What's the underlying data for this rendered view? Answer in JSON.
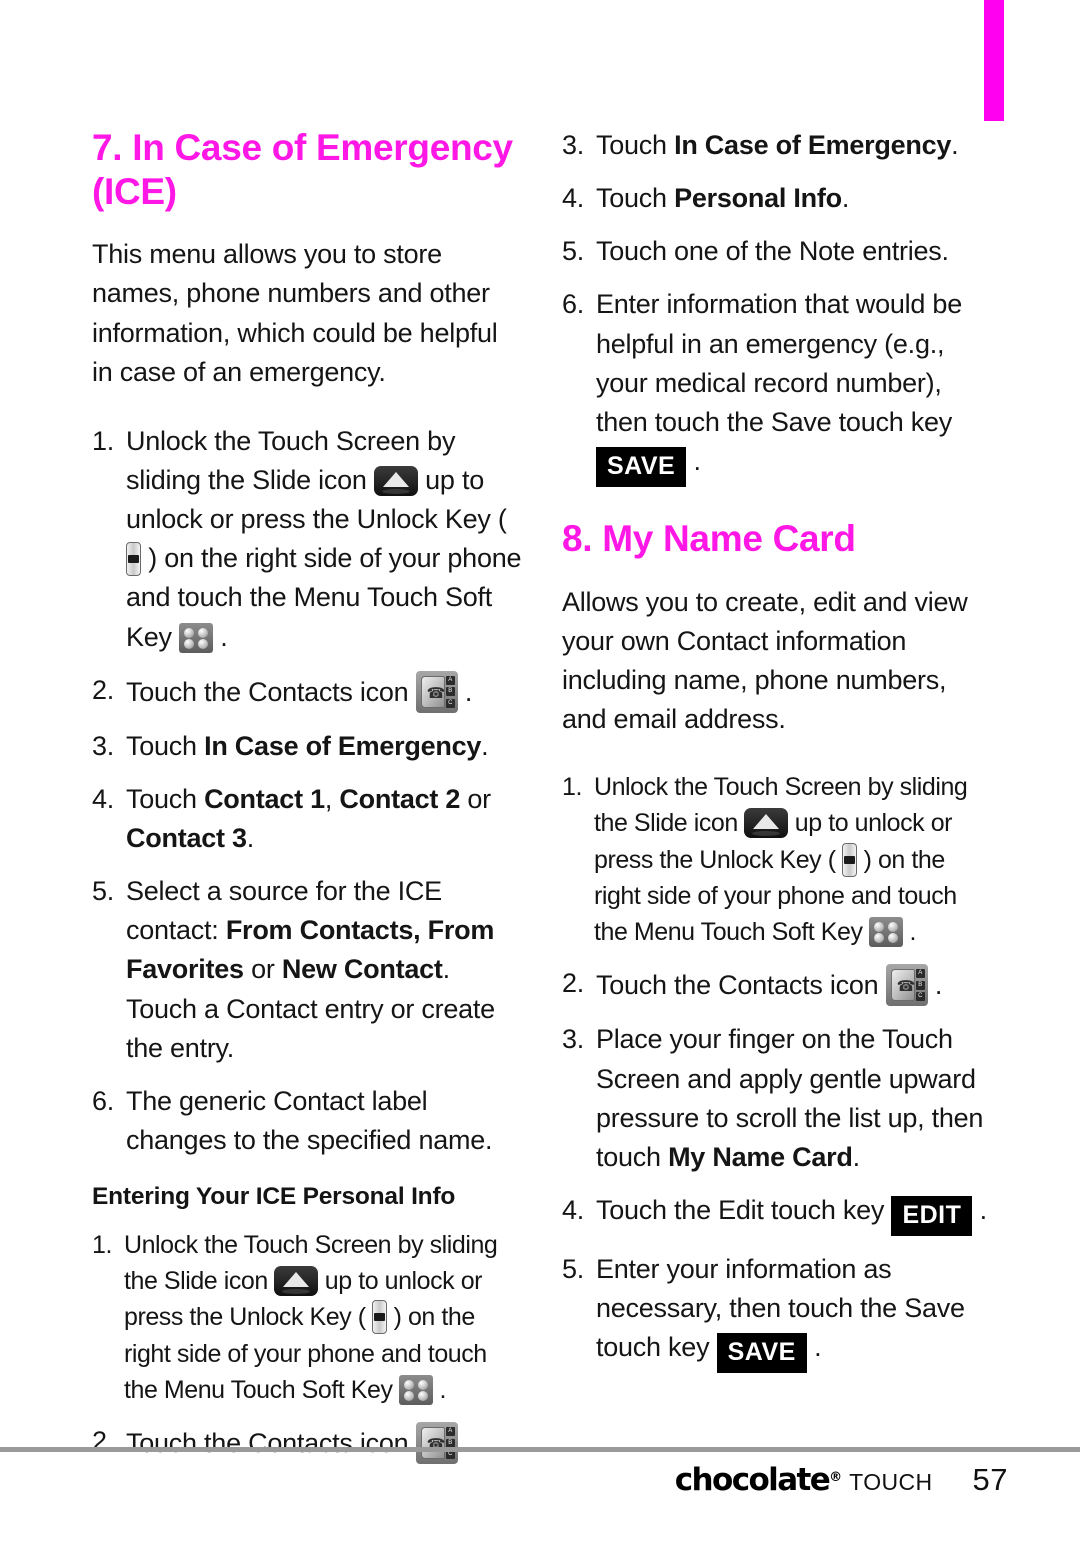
{
  "colors": {
    "heading_pink": "#ff17e6",
    "edge_tab": "#ff00f0",
    "body_text": "#151515",
    "key_badge_bg": "#000000",
    "footer_rule": "#9a9a9a"
  },
  "left_column": {
    "chapter_heading_line1": "7. In Case of Emergency",
    "chapter_heading_line2": "(ICE)",
    "intro": "This menu allows you to store names, phone numbers and other information, which could be helpful in case of an emergency.",
    "steps": [
      {
        "num": "1.",
        "parts": [
          {
            "t": "text",
            "v": "Unlock the Touch Screen by sliding the Slide icon "
          },
          {
            "t": "icon",
            "v": "slide-icon"
          },
          {
            "t": "text",
            "v": " up to unlock or press the Unlock Key ( "
          },
          {
            "t": "icon",
            "v": "unlock-key-icon"
          },
          {
            "t": "text",
            "v": " ) on the right side of your phone and touch the Menu Touch Soft Key "
          },
          {
            "t": "icon",
            "v": "menu-soft-key-icon"
          },
          {
            "t": "text",
            "v": " ."
          }
        ]
      },
      {
        "num": "2.",
        "parts": [
          {
            "t": "text",
            "v": "Touch the Contacts icon "
          },
          {
            "t": "icon",
            "v": "contacts-icon"
          },
          {
            "t": "text",
            "v": " ."
          }
        ]
      },
      {
        "num": "3.",
        "parts": [
          {
            "t": "text",
            "v": "Touch "
          },
          {
            "t": "bold",
            "v": "In Case of Emergency"
          },
          {
            "t": "text",
            "v": "."
          }
        ]
      },
      {
        "num": "4.",
        "parts": [
          {
            "t": "text",
            "v": "Touch "
          },
          {
            "t": "bold",
            "v": "Contact 1"
          },
          {
            "t": "text",
            "v": ", "
          },
          {
            "t": "bold",
            "v": "Contact 2"
          },
          {
            "t": "text",
            "v": " or "
          },
          {
            "t": "bold",
            "v": "Contact 3"
          },
          {
            "t": "text",
            "v": "."
          }
        ]
      },
      {
        "num": "5.",
        "parts": [
          {
            "t": "text",
            "v": "Select a source for the ICE contact: "
          },
          {
            "t": "bold",
            "v": "From Contacts, From Favorites"
          },
          {
            "t": "text",
            "v": " or "
          },
          {
            "t": "bold",
            "v": "New Contact"
          },
          {
            "t": "text",
            "v": ". Touch a Contact entry or create the entry."
          }
        ]
      },
      {
        "num": "6.",
        "parts": [
          {
            "t": "text",
            "v": "The generic Contact label changes to the specified name."
          }
        ]
      }
    ],
    "subheading": "Entering Your ICE Personal Info",
    "sub_steps": [
      {
        "num": "1.",
        "parts": [
          {
            "t": "text",
            "v": "Unlock the Touch Screen by sliding the Slide icon "
          },
          {
            "t": "icon",
            "v": "slide-icon"
          },
          {
            "t": "text",
            "v": " up to unlock or press the Unlock Key ( "
          },
          {
            "t": "icon",
            "v": "unlock-key-icon"
          },
          {
            "t": "text",
            "v": " ) on the right side of your phone and touch the Menu Touch Soft Key "
          },
          {
            "t": "icon",
            "v": "menu-soft-key-icon"
          },
          {
            "t": "text",
            "v": " ."
          }
        ]
      },
      {
        "num": "2.",
        "parts": [
          {
            "t": "text",
            "v": "Touch the Contacts icon "
          },
          {
            "t": "icon",
            "v": "contacts-icon"
          },
          {
            "t": "text",
            "v": " ."
          }
        ]
      }
    ]
  },
  "right_column": {
    "cont_steps": [
      {
        "num": "3.",
        "parts": [
          {
            "t": "text",
            "v": "Touch "
          },
          {
            "t": "bold",
            "v": "In Case of Emergency"
          },
          {
            "t": "text",
            "v": "."
          }
        ]
      },
      {
        "num": "4.",
        "parts": [
          {
            "t": "text",
            "v": "Touch "
          },
          {
            "t": "bold",
            "v": "Personal Info"
          },
          {
            "t": "text",
            "v": "."
          }
        ]
      },
      {
        "num": "5.",
        "parts": [
          {
            "t": "text",
            "v": "Touch one of the Note entries."
          }
        ]
      },
      {
        "num": "6.",
        "parts": [
          {
            "t": "text",
            "v": "Enter information that would be helpful in an emergency (e.g., your medical record number), then touch the Save touch key "
          },
          {
            "t": "badge",
            "v": "SAVE"
          },
          {
            "t": "text",
            "v": " ."
          }
        ]
      }
    ],
    "chapter_heading": "8. My Name Card",
    "intro": "Allows you to create, edit and view your own Contact information including name, phone numbers, and email address.",
    "steps": [
      {
        "num": "1.",
        "parts": [
          {
            "t": "text",
            "v": "Unlock the Touch Screen by sliding the Slide icon "
          },
          {
            "t": "icon",
            "v": "slide-icon"
          },
          {
            "t": "text",
            "v": " up to unlock or press the Unlock Key ( "
          },
          {
            "t": "icon",
            "v": "unlock-key-icon"
          },
          {
            "t": "text",
            "v": " ) on the right side of your phone and touch the Menu Touch Soft Key "
          },
          {
            "t": "icon",
            "v": "menu-soft-key-icon"
          },
          {
            "t": "text",
            "v": " ."
          }
        ]
      },
      {
        "num": "2.",
        "parts": [
          {
            "t": "text",
            "v": "Touch the Contacts icon "
          },
          {
            "t": "icon",
            "v": "contacts-icon"
          },
          {
            "t": "text",
            "v": " ."
          }
        ]
      },
      {
        "num": "3.",
        "parts": [
          {
            "t": "text",
            "v": "Place your finger on the Touch Screen and apply gentle upward pressure to scroll the list up, then touch "
          },
          {
            "t": "bold",
            "v": "My Name Card"
          },
          {
            "t": "text",
            "v": "."
          }
        ]
      },
      {
        "num": "4.",
        "parts": [
          {
            "t": "text",
            "v": "Touch the Edit touch key "
          },
          {
            "t": "badge",
            "v": "EDIT"
          },
          {
            "t": "text",
            "v": " ."
          }
        ]
      },
      {
        "num": "5.",
        "parts": [
          {
            "t": "text",
            "v": "Enter your information as necessary, then touch the Save touch key "
          },
          {
            "t": "badge",
            "v": "SAVE"
          },
          {
            "t": "text",
            "v": " ."
          }
        ]
      }
    ]
  },
  "footer": {
    "logo_name": "chocolate",
    "logo_reg": "®",
    "logo_sub": "TOUCH",
    "page_number": "57"
  },
  "icon_names": {
    "slide": "slide-icon",
    "unlock_key": "unlock-key-icon",
    "menu_soft_key": "menu-soft-key-icon",
    "contacts": "contacts-icon"
  }
}
